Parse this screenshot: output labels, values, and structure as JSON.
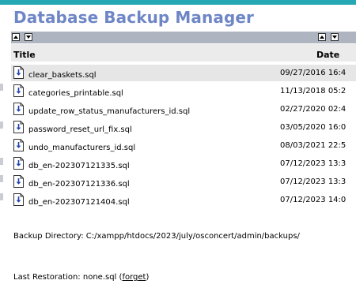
{
  "page": {
    "title": "Database Backup Manager"
  },
  "table": {
    "columns": {
      "title": "Title",
      "date": "Date"
    },
    "rows": [
      {
        "name": "clear_baskets.sql",
        "date": "09/27/2016 16:4",
        "selected": true
      },
      {
        "name": "categories_printable.sql",
        "date": "11/13/2018 05:2"
      },
      {
        "name": "update_row_status_manufacturers_id.sql",
        "date": "02/27/2020 02:4"
      },
      {
        "name": "password_reset_url_fix.sql",
        "date": "03/05/2020 16:0"
      },
      {
        "name": "undo_manufacturers_id.sql",
        "date": "08/03/2021 22:5"
      },
      {
        "name": "db_en-202307121335.sql",
        "date": "07/12/2023 13:3"
      },
      {
        "name": "db_en-202307121336.sql",
        "date": "07/12/2023 13:3"
      },
      {
        "name": "db_en-202307121404.sql",
        "date": "07/12/2023 14:0"
      }
    ],
    "file_icon": "sql-file-download-icon",
    "sort_icons": [
      "sort-ascending-icon",
      "sort-descending-icon"
    ]
  },
  "backup_directory": {
    "label": "Backup Directory:",
    "path": "C:/xampp/htdocs/2023/july/osconcert/admin/backups/"
  },
  "last_restoration": {
    "label": "Last Restoration:",
    "file": "none.sql",
    "open_paren": "(",
    "forget_label": "forget",
    "close_paren": ")"
  },
  "colors": {
    "accent_bar": "#25a7b4",
    "title": "#6f86c6",
    "sort_bar": "#aeb4c0",
    "header_bg": "#ebebeb",
    "selected_row": "#e6e6e6"
  }
}
